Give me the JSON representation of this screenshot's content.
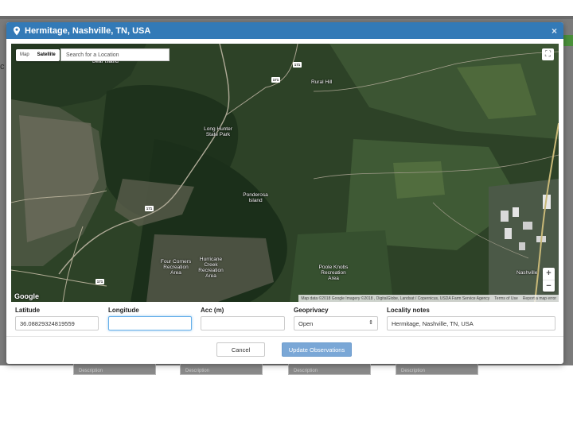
{
  "modal": {
    "title": "Hermitage, Nashville, TN, USA",
    "close_label": "×"
  },
  "map": {
    "type_map": "Map",
    "type_satellite": "Satellite",
    "search_placeholder": "Search for a Location",
    "zoom_in": "+",
    "zoom_out": "−",
    "google": "Google",
    "attribution": "Map data ©2018 Google Imagery ©2018 , DigitalGlobe, Landsat / Copernicus, USDA Farm Service Agency",
    "terms": "Terms of Use",
    "report": "Report a map error",
    "places": {
      "bear_island": "Bear Island",
      "rural_hill": "Rural Hill",
      "long_hunter": "Long Hunter State Park",
      "ponderosa": "Ponderosa Island",
      "four_corners": "Four Corners Recreation Area",
      "hurricane_creek": "Hurricane Creek Recreation Area",
      "poole_knobs": "Poole Knobs Recreation Area",
      "nashville": "Nashville"
    },
    "roads": {
      "r1": "171",
      "r2": "171",
      "r3": "171",
      "r4": "171"
    }
  },
  "form": {
    "latitude_label": "Latitude",
    "latitude_value": "36.08829324819559",
    "longitude_label": "Longitude",
    "longitude_value": "",
    "acc_label": "Acc (m)",
    "acc_value": "",
    "geoprivacy_label": "Geoprivacy",
    "geoprivacy_value": "Open",
    "locality_label": "Locality notes",
    "locality_value": "Hermitage, Nashville, TN, USA"
  },
  "footer": {
    "cancel_label": "Cancel",
    "update_label": "Update Observations"
  },
  "background": {
    "letter": "c",
    "desc_label": "Description"
  },
  "colors": {
    "header": "#337ab7",
    "update_button": "#7aa7d6"
  }
}
